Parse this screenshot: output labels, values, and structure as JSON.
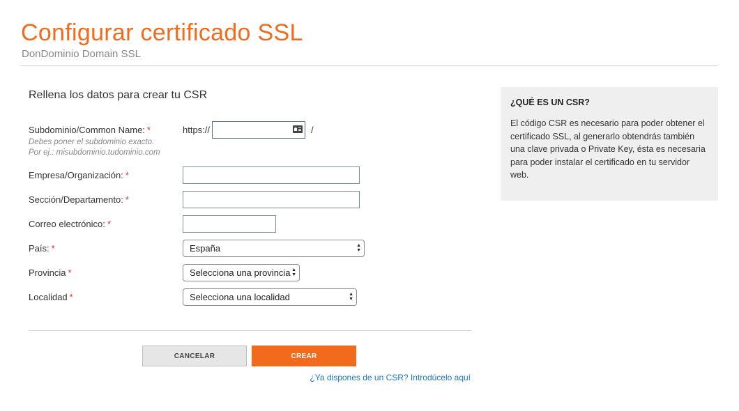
{
  "header": {
    "title": "Configurar certificado SSL",
    "subtitle": "DonDominio Domain SSL"
  },
  "form": {
    "heading": "Rellena los datos para crear tu CSR",
    "required_mark": "*",
    "subdomain": {
      "label": "Subdominio/Common Name:",
      "hint_line1": "Debes poner el subdominio exacto.",
      "hint_line2": "Por ej.: misubdominio.tudominio.com",
      "prefix": "https://",
      "suffix": "/",
      "value": "",
      "icon": "contact-card-icon"
    },
    "empresa": {
      "label": "Empresa/Organización:",
      "value": ""
    },
    "seccion": {
      "label": "Sección/Departamento:",
      "value": ""
    },
    "correo": {
      "label": "Correo electrónico:",
      "value": ""
    },
    "pais": {
      "label": "País:",
      "selected": "España"
    },
    "provincia": {
      "label": "Provincia",
      "selected": "Selecciona una provincia"
    },
    "localidad": {
      "label": "Localidad",
      "selected": "Selecciona una localidad"
    }
  },
  "actions": {
    "cancel_label": "CANCELAR",
    "create_label": "CREAR",
    "existing_csr_link": "¿Ya dispones de un CSR? Introdúcelo aquí"
  },
  "aside": {
    "title": "¿QUÉ ES UN CSR?",
    "body": "El código CSR es necesario para poder obtener el certificado SSL, al generarlo obtendrás también una clave privada o Private Key, ésta es necesaria para poder instalar el certificado en tu servidor web."
  },
  "colors": {
    "brand_orange": "#f26b1d",
    "link_blue": "#1a78c8",
    "required_red": "#e0301e"
  }
}
